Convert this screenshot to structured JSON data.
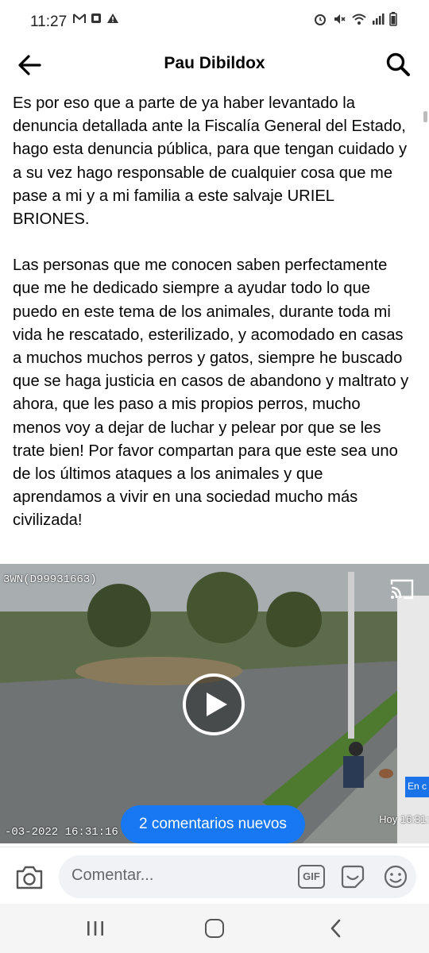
{
  "status_bar": {
    "time": "11:27",
    "left_icons": [
      "gmail-icon",
      "notification-icon",
      "warning-icon"
    ],
    "right_icons": [
      "alarm-icon",
      "mute-icon",
      "wifi-icon",
      "signal-icon",
      "battery-icon"
    ]
  },
  "header": {
    "title": "Pau Dibildox"
  },
  "post": {
    "paragraphs": [
      "Es por eso que a parte de ya haber levantado la denuncia detallada ante la Fiscalía General del Estado, hago esta denuncia pública, para que tengan cuidado y a su vez hago responsable de cualquier cosa que me pase a mi y a mi familia a este salvaje URIEL BRIONES.",
      "Las personas que me conocen saben perfectamente que me he dedicado siempre a ayudar todo lo que puedo en este tema de los animales, durante toda mi vida he rescatado, esterilizado, y acomodado en casas a muchos muchos perros y gatos, siempre he buscado que se haga justicia en casos de abandono y maltrato y ahora, que les paso a mis propios perros, mucho menos voy a dejar de luchar y pelear por que se les trate bien! Por favor compartan para que este sea uno de los últimos ataques a los animales y que aprendamos a vivir en una sociedad mucho más civilizada!"
    ]
  },
  "video": {
    "overlay_label": "3WN(D99931663)",
    "timestamp": "-03-2022 16:31:16",
    "right_label": "En c",
    "right_timestamp": "Hoy 16:31:"
  },
  "new_comments_button": "2 comentarios nuevos",
  "comment_bar": {
    "placeholder": "Comentar...",
    "gif_label": "GIF"
  },
  "colors": {
    "accent": "#1877f2",
    "input_bg": "#f0f2f5",
    "nav_bg": "#f5f5f5"
  }
}
